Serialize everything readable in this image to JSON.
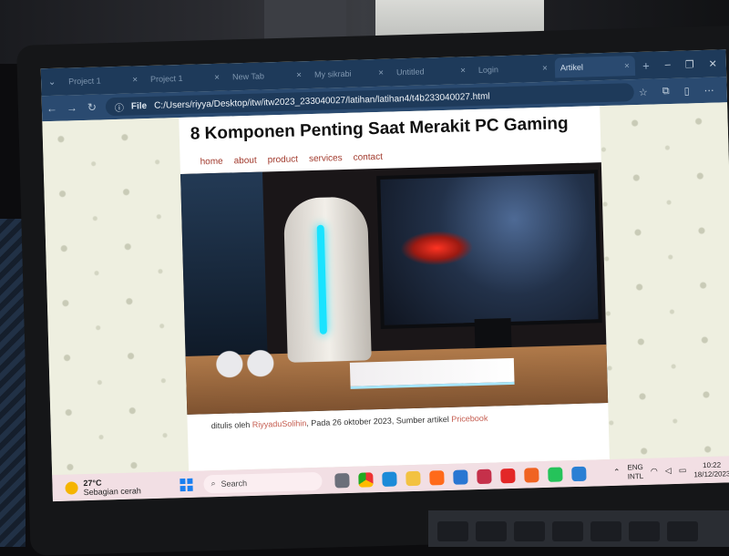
{
  "browser": {
    "tabs": [
      {
        "label": "Project 1",
        "active": false
      },
      {
        "label": "Project 1",
        "active": false
      },
      {
        "label": "New Tab",
        "active": false
      },
      {
        "label": "My sikrabi",
        "active": false
      },
      {
        "label": "Untitled",
        "active": false
      },
      {
        "label": "Login",
        "active": false
      },
      {
        "label": "Artikel",
        "active": true
      }
    ],
    "info_label": "File",
    "url": "C:/Users/riyya/Desktop/itw/itw2023_233040027/latihan/latihan4/t4b233040027.html"
  },
  "page": {
    "title": "8 Komponen Penting Saat Merakit PC Gaming",
    "nav": [
      "home",
      "about",
      "product",
      "services",
      "contact"
    ],
    "credit": {
      "prefix": "ditulis oleh",
      "author": "RiyyaduSolihin",
      "middle": ", Pada 26 oktober 2023, Sumber artikel",
      "source": "Pricebook"
    }
  },
  "taskbar": {
    "weather_temp": "27°C",
    "weather_desc": "Sebagian cerah",
    "search_label": "Search",
    "lang_1": "ENG",
    "lang_2": "INTL",
    "time": "10:22",
    "date": "18/12/2023",
    "apps": [
      "file-explorer-icon",
      "chrome-icon",
      "edge-icon",
      "folder-icon",
      "firefox-icon",
      "store-icon",
      "vivaldi-icon",
      "youtube-icon",
      "brave-icon",
      "whatsapp-icon",
      "vscode-icon"
    ]
  },
  "colors": {
    "tab_bar": "#1e3a5a",
    "nav_link": "#a23b2e",
    "credit_link": "#c45b4e",
    "taskbar": "#f2dfe4"
  }
}
